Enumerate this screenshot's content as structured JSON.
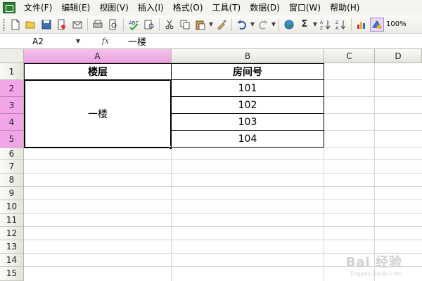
{
  "menu": {
    "items": [
      "文件(F)",
      "编辑(E)",
      "视图(V)",
      "插入(I)",
      "格式(O)",
      "工具(T)",
      "数据(D)",
      "窗口(W)",
      "帮助(H)"
    ]
  },
  "toolbar": {
    "zoom": "100%",
    "sum_symbol": "Σ"
  },
  "formula_bar": {
    "name_box": "A2",
    "fx_label": "fx",
    "content": "一楼"
  },
  "grid": {
    "columns": [
      "A",
      "B",
      "C",
      "D"
    ],
    "selected_column": "A",
    "rows": [
      "1",
      "2",
      "3",
      "4",
      "5",
      "6",
      "7",
      "8",
      "9",
      "10",
      "11",
      "12",
      "13",
      "14",
      "15"
    ],
    "selected_rows": [
      "2",
      "3",
      "4",
      "5"
    ]
  },
  "cells": {
    "A1": "楼层",
    "B1": "房间号",
    "A2_merged": "一楼",
    "B2": "101",
    "B3": "102",
    "B4": "103",
    "B5": "104"
  },
  "watermark": {
    "main": "Bai 经验",
    "sub": "jingyan.baidu.com"
  },
  "colors": {
    "selected_header": "#f2a6e7",
    "header_bg": "#ecebe6",
    "grid_line": "#d4d4d4"
  }
}
